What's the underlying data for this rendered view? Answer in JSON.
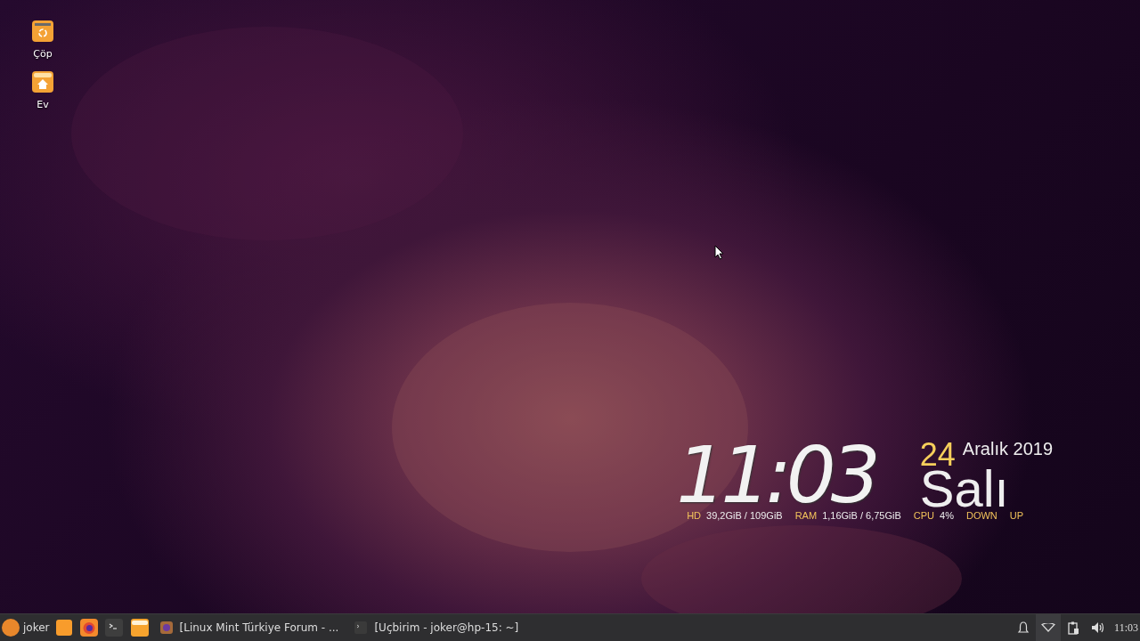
{
  "desktop_icons": [
    {
      "label": "Çöp",
      "kind": "trash"
    },
    {
      "label": "Ev",
      "kind": "home"
    }
  ],
  "conky": {
    "time": "11:03",
    "day": "24",
    "month_year": "Aralık 2019",
    "weekday": "Salı",
    "stats": [
      {
        "label": "HD",
        "value": "39,2GiB / 109GiB"
      },
      {
        "label": "RAM",
        "value": "1,16GiB / 6,75GiB"
      },
      {
        "label": "CPU",
        "value": "4%"
      },
      {
        "label": "DOWN"
      },
      {
        "label": "UP"
      }
    ]
  },
  "taskbar": {
    "menu_label": "joker",
    "launchers": [
      {
        "kind": "files"
      },
      {
        "kind": "firefox"
      },
      {
        "kind": "terminal"
      },
      {
        "kind": "folder"
      }
    ],
    "windows": [
      {
        "kind": "firefox",
        "title": "[Linux Mint Türkiye Forum - ..."
      },
      {
        "kind": "terminal",
        "title": "[Uçbirim - joker@hp-15: ~]"
      }
    ],
    "tray": [
      {
        "kind": "bell",
        "selected": false
      },
      {
        "kind": "wifi",
        "selected": true
      },
      {
        "kind": "clipboard",
        "selected": false
      },
      {
        "kind": "volume",
        "selected": false
      }
    ],
    "clock": "11:03"
  }
}
